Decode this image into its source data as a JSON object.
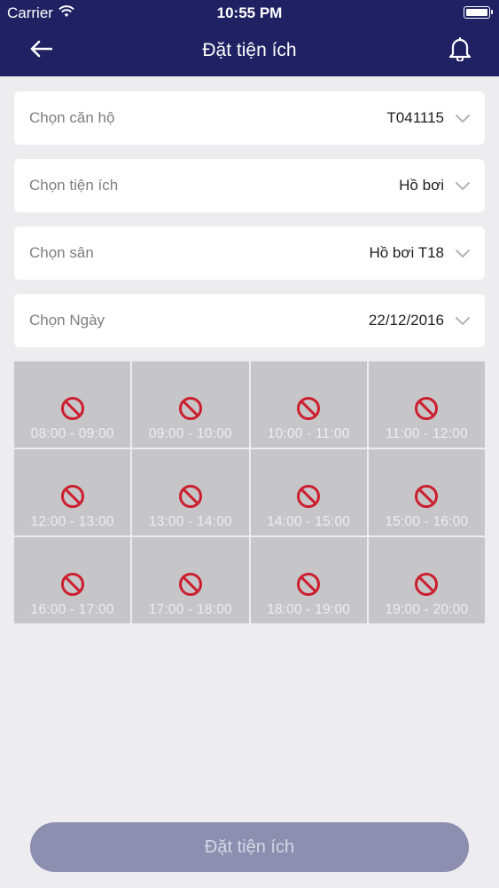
{
  "status": {
    "carrier": "Carrier",
    "time": "10:55 PM"
  },
  "nav": {
    "title": "Đặt tiện ích",
    "back_icon": "arrow-left-icon",
    "bell_icon": "bell-icon"
  },
  "form": {
    "apartment": {
      "label": "Chọn căn hộ",
      "value": "T041115"
    },
    "facility": {
      "label": "Chọn tiện ích",
      "value": "Hồ bơi"
    },
    "court": {
      "label": "Chọn sân",
      "value": "Hồ bơi T18"
    },
    "date": {
      "label": "Chọn Ngày",
      "value": "22/12/2016"
    }
  },
  "slots": [
    "08:00 - 09:00",
    "09:00 - 10:00",
    "10:00 - 11:00",
    "11:00 - 12:00",
    "12:00 - 13:00",
    "13:00 - 14:00",
    "14:00 - 15:00",
    "15:00 - 16:00",
    "16:00 - 17:00",
    "17:00 - 18:00",
    "18:00 - 19:00",
    "19:00 - 20:00"
  ],
  "slot_status": "unavailable",
  "slot_icon": "no-entry-icon",
  "colors": {
    "header": "#1f2163",
    "unavailable": "#c6c5c8",
    "no_entry": "#cc1f2e",
    "button": "#8d8fb1"
  },
  "book_button": {
    "label": "Đặt tiện ích"
  }
}
